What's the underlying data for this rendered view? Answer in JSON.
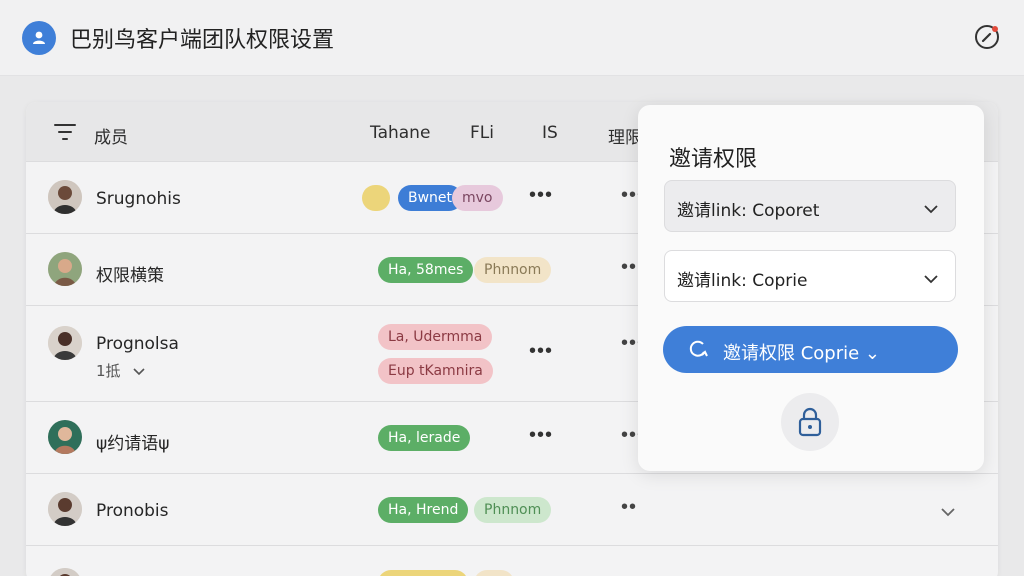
{
  "header": {
    "title": "巴别鸟客户端团队权限设置",
    "logo_icon": "user-icon",
    "action_icon": "compass-edit-icon"
  },
  "table": {
    "columns": [
      "成员",
      "Tahane",
      "FLi",
      "IS",
      "理限"
    ],
    "rows": [
      {
        "name": "Srugnohis",
        "avatar": "person",
        "pills": [
          "Bwnet",
          "mvo"
        ],
        "dots": "•••"
      },
      {
        "name": "权限横策",
        "avatar": "person",
        "pills": [
          "Ha, 58mes",
          "Phnnom"
        ],
        "dots": "••"
      },
      {
        "name": "Prognolsa",
        "sub": "1抵",
        "avatar": "person",
        "pills": [
          "La, Udermma",
          "Eup tKamnira"
        ],
        "dots": "•••"
      },
      {
        "name": "ψ约请语ψ",
        "avatar": "person",
        "pills": [
          "Ha, lerade"
        ],
        "dots": "•••"
      },
      {
        "name": "Pronobis",
        "avatar": "person",
        "pills": [
          "Ha, Hrend",
          "Phnnom"
        ],
        "dots": "••"
      }
    ]
  },
  "popover": {
    "title": "邀请权限",
    "select1": "邀请link: Coporet",
    "select2": "邀请link: Coprie",
    "button": "邀请权限 Coprie ⌄",
    "lock_icon": "lock-icon"
  },
  "colors": {
    "accent": "#3f7fd8",
    "green": "#5cae66",
    "pink": "#f2c3c7",
    "sand": "#f2e4c8"
  }
}
